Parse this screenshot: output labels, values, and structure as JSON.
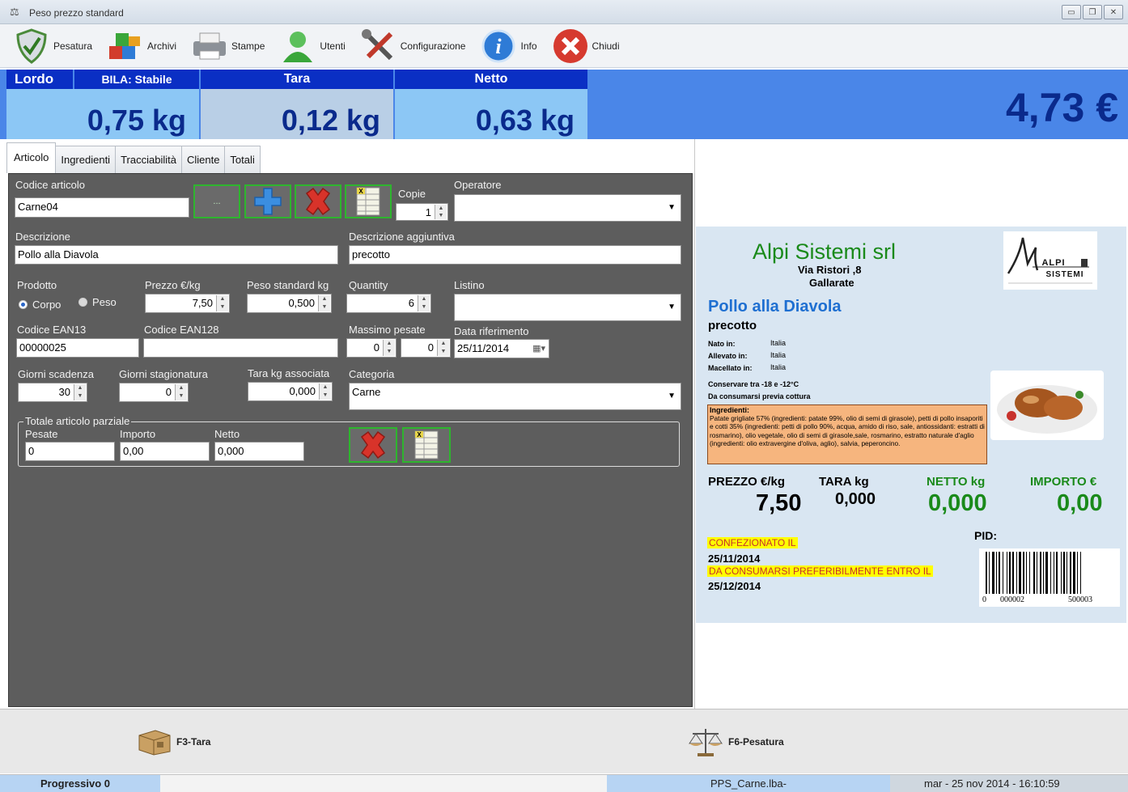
{
  "window": {
    "title": "Peso prezzo standard"
  },
  "toolbar": {
    "pesatura": "Pesatura",
    "archivi": "Archivi",
    "stampe": "Stampe",
    "utenti": "Utenti",
    "configurazione": "Configurazione",
    "info": "Info",
    "chiudi": "Chiudi"
  },
  "weights": {
    "lordo_label": "Lordo",
    "status": "BILA: Stabile",
    "lordo_value": "0,75 kg",
    "tara_label": "Tara",
    "tara_value": "0,12 kg",
    "netto_label": "Netto",
    "netto_value": "0,63 kg",
    "total": "4,73 €"
  },
  "tabs": [
    "Articolo",
    "Ingredienti",
    "Tracciabilità",
    "Cliente",
    "Totali"
  ],
  "form": {
    "codice_articolo_label": "Codice articolo",
    "codice_articolo": "Carne04",
    "browse_button": "...",
    "copie_label": "Copie",
    "copie": "1",
    "operatore_label": "Operatore",
    "operatore": "",
    "descrizione_label": "Descrizione",
    "descrizione": "Pollo alla Diavola",
    "descrizione_agg_label": "Descrizione aggiuntiva",
    "descrizione_agg": "precotto",
    "prodotto_label": "Prodotto",
    "radio_corpo": "Corpo",
    "radio_peso": "Peso",
    "prezzo_label": "Prezzo €/kg",
    "prezzo": "7,50",
    "peso_std_label": "Peso standard kg",
    "peso_std": "0,500",
    "quantity_label": "Quantity",
    "quantity": "6",
    "listino_label": "Listino",
    "listino": "",
    "ean13_label": "Codice EAN13",
    "ean13": "00000025",
    "ean128_label": "Codice EAN128",
    "ean128": "",
    "massimo_label": "Massimo pesate",
    "massimo_a": "0",
    "massimo_b": "0",
    "data_rif_label": "Data riferimento",
    "data_rif": "25/11/2014",
    "giorni_scad_label": "Giorni scadenza",
    "giorni_scad": "30",
    "giorni_stag_label": "Giorni stagionatura",
    "giorni_stag": "0",
    "tara_assoc_label": "Tara kg associata",
    "tara_assoc": "0,000",
    "categoria_label": "Categoria",
    "categoria": "Carne",
    "totale_parziale_label": "Totale articolo parziale",
    "pesate_label": "Pesate",
    "pesate": "0",
    "importo_label": "Importo",
    "importo": "0,00",
    "netto_label": "Netto",
    "netto": "0,000"
  },
  "label_preview": {
    "company": "Alpi Sistemi srl",
    "address": "Via Ristori ,8",
    "city": "Gallarate",
    "logo_text1": "ALPI",
    "logo_text2": "SISTEMI",
    "product": "Pollo alla Diavola",
    "subtitle": "precotto",
    "nato_label": "Nato in:",
    "nato": "Italia",
    "allevato_label": "Allevato in:",
    "allevato": "Italia",
    "macellato_label": "Macellato in:",
    "macellato": "Italia",
    "conservare": "Conservare tra -18 e -12°C",
    "consumarsi": "Da consumarsi previa cottura",
    "ingredienti_title": "Ingredienti:",
    "ingredienti_text": "Patate grigliate 57% (ingredienti: patate 99%, olio di semi di girasole), petti di pollo insaporiti e cotti 35% (ingredienti: petti di pollo 90%, acqua, amido di riso, sale, antiossidanti: estratti di rosmarino), olio vegetale, olio di semi di girasole,sale, rosmarino, estratto naturale d'aglio (ingredienti: olio extravergine d'oliva, aglio), salvia, peperoncino.",
    "prezzo_label": "PREZZO €/kg",
    "prezzo": "7,50",
    "tara_label": "TARA kg",
    "tara": "0,000",
    "netto_label": "NETTO kg",
    "netto": "0,000",
    "importo_label": "IMPORTO €",
    "importo": "0,00",
    "pid_label": "PID:",
    "confezionato_label": "CONFEZIONATO IL",
    "confezionato": "25/11/2014",
    "preferibilmente_label": "DA CONSUMARSI PREFERIBILMENTE ENTRO IL",
    "preferibilmente": "25/12/2014",
    "barcode_a": "0",
    "barcode_b": "000002",
    "barcode_c": "500003"
  },
  "bottom": {
    "f3": "F3-Tara",
    "f6": "F6-Pesatura"
  },
  "status": {
    "progressivo": "Progressivo 0",
    "file": "PPS_Carne.lba-",
    "datetime": "mar - 25 nov 2014 - 16:10:59"
  },
  "colors": {
    "weight_header": "#0a2fc4",
    "weight_body": "#8cc7f5",
    "weight_value": "#0a2a8c",
    "panel": "#5d5d5d",
    "label_bg": "#d9e6f2",
    "netto_green": "#1a8a1a"
  }
}
